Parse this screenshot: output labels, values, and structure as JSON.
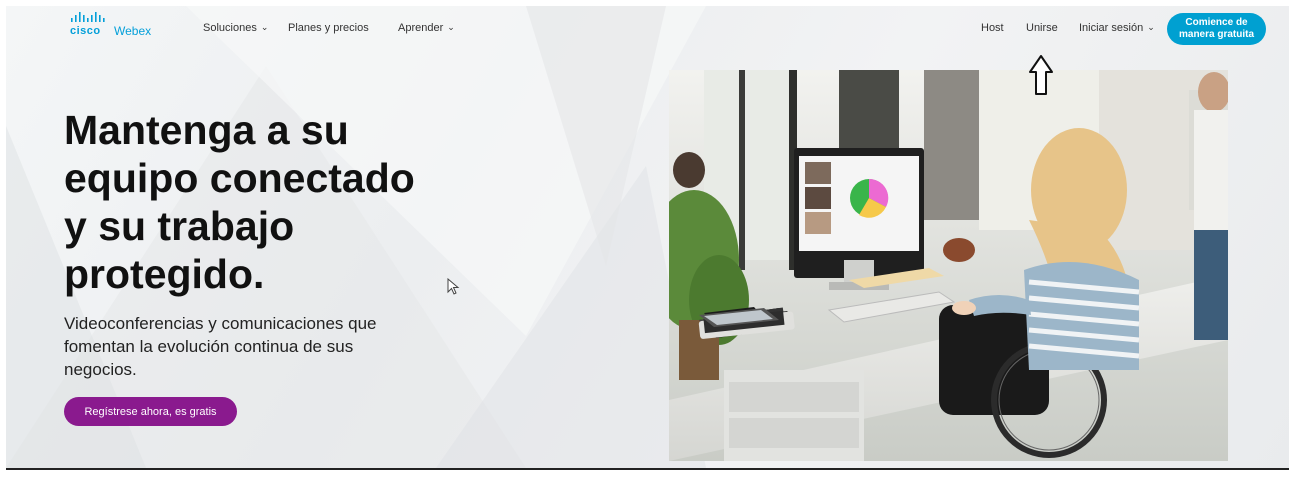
{
  "brand": {
    "cisco": "cisco",
    "product": "Webex"
  },
  "nav": {
    "soluciones": "Soluciones",
    "planes": "Planes y precios",
    "aprender": "Aprender",
    "host": "Host",
    "unirse": "Unirse",
    "iniciar": "Iniciar sesión",
    "cta_line1": "Comience de",
    "cta_line2": "manera gratuita"
  },
  "hero": {
    "headline_l1": "Mantenga a su",
    "headline_l2": "equipo conectado",
    "headline_l3": "y su trabajo",
    "headline_l4": "protegido.",
    "sub_l1": "Videoconferencias y comunicaciones que",
    "sub_l2": "fomentan la evolución continua de sus",
    "sub_l3": "negocios.",
    "signup": "Regístrese ahora, es gratis"
  },
  "colors": {
    "brand_blue": "#00a0d1",
    "signup_purple": "#8a1a8e"
  },
  "icons": [
    "cisco-logo-icon",
    "chevron-down-icon",
    "mouse-cursor-icon",
    "up-arrow-annotation-icon"
  ]
}
